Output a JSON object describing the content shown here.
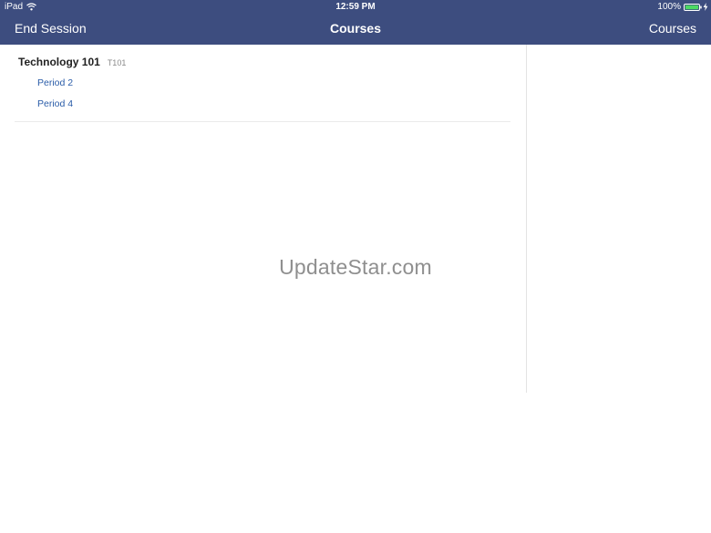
{
  "status_bar": {
    "device": "iPad",
    "time": "12:59 PM",
    "battery": "100%",
    "icons": [
      "wifi-icon",
      "battery-icon",
      "charging-icon"
    ],
    "battery_color": "#4cd964"
  },
  "nav": {
    "left_label": "End Session",
    "title": "Courses",
    "right_label": "Courses",
    "background_color": "#3d4d7f"
  },
  "course": {
    "name": "Technology 101",
    "code": "T101",
    "periods": [
      "Period 2",
      "Period 4"
    ],
    "link_color": "#2a5ca8"
  },
  "watermark": "UpdateStar.com"
}
